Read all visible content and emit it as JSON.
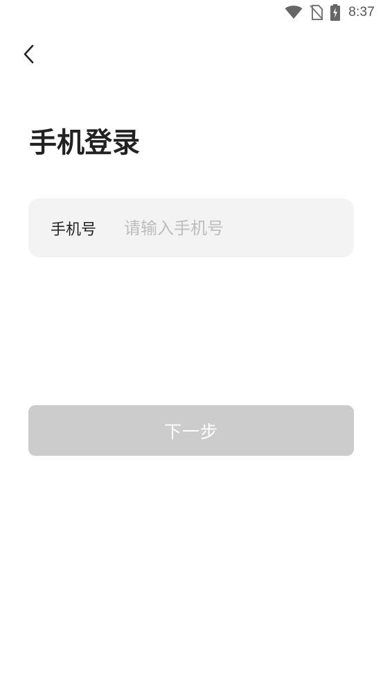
{
  "status_bar": {
    "time": "8:37",
    "icons": [
      "wifi-icon",
      "no-sim-icon",
      "battery-charging-icon"
    ]
  },
  "header": {
    "back_icon": "chevron-left-icon"
  },
  "main": {
    "title": "手机登录",
    "phone_field": {
      "label": "手机号",
      "value": "",
      "placeholder": "请输入手机号"
    },
    "next_button": {
      "label": "下一步",
      "enabled": false
    }
  },
  "colors": {
    "field_background": "#f3f3f3",
    "button_disabled": "#cccccc",
    "placeholder": "#bdbdbd",
    "text_primary": "#222222"
  }
}
